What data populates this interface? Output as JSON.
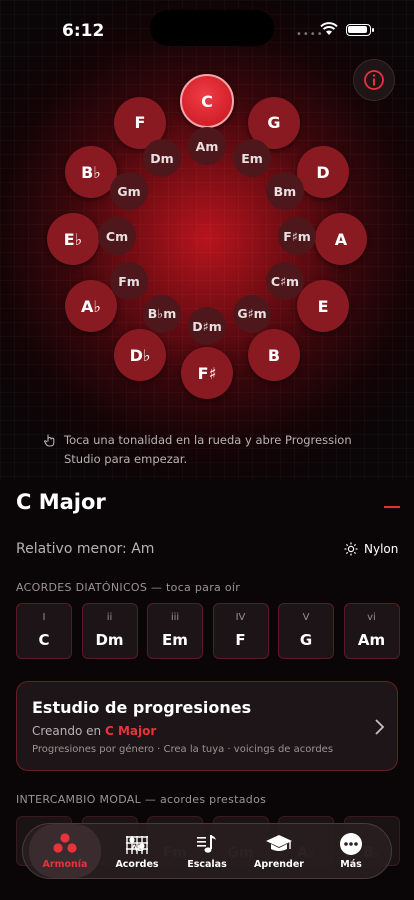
{
  "status_bar": {
    "time": "6:12"
  },
  "wheel": {
    "major_keys": [
      "C",
      "G",
      "D",
      "A",
      "E",
      "B",
      "F♯",
      "D♭",
      "A♭",
      "E♭",
      "B♭",
      "F"
    ],
    "minor_keys": [
      "Am",
      "Em",
      "Bm",
      "F♯m",
      "C♯m",
      "G♯m",
      "D♯m",
      "B♭m",
      "Fm",
      "Cm",
      "Gm",
      "Dm"
    ],
    "selected": "C"
  },
  "hint": "Toca una tonalidad en la rueda y abre Progression Studio para empezar.",
  "key_info": {
    "title": "C Major",
    "relative_minor": "Relativo menor: Am",
    "sound": "Nylon"
  },
  "diatonic": {
    "label": "ACORDES DIATÓNICOS — toca para oír",
    "chords": [
      {
        "numeral": "I",
        "name": "C"
      },
      {
        "numeral": "ii",
        "name": "Dm"
      },
      {
        "numeral": "iii",
        "name": "Em"
      },
      {
        "numeral": "IV",
        "name": "F"
      },
      {
        "numeral": "V",
        "name": "G"
      },
      {
        "numeral": "vi",
        "name": "Am"
      }
    ]
  },
  "progressions": {
    "title": "Estudio de progresiones",
    "creating_prefix": "Creando en",
    "creating_key": "C Major",
    "description": "Progresiones por género · Crea la tuya · voicings de acordes"
  },
  "modal": {
    "label": "INTERCAMBIO MODAL — acordes prestados",
    "chords": [
      "",
      "",
      "Fm",
      "Gm",
      "A♭",
      "B♭"
    ]
  },
  "tabs": [
    {
      "label": "Armonía",
      "icon": "circle-of-fifths-icon",
      "active": true
    },
    {
      "label": "Acordes",
      "icon": "guitar-chord-icon",
      "active": false
    },
    {
      "label": "Escalas",
      "icon": "music-notes-icon",
      "active": false
    },
    {
      "label": "Aprender",
      "icon": "graduation-cap-icon",
      "active": false
    },
    {
      "label": "Más",
      "icon": "more-icon",
      "active": false
    }
  ],
  "colors": {
    "accent": "#e8333d",
    "major_key": "#8a1a22",
    "minor_key": "#4e171b"
  }
}
